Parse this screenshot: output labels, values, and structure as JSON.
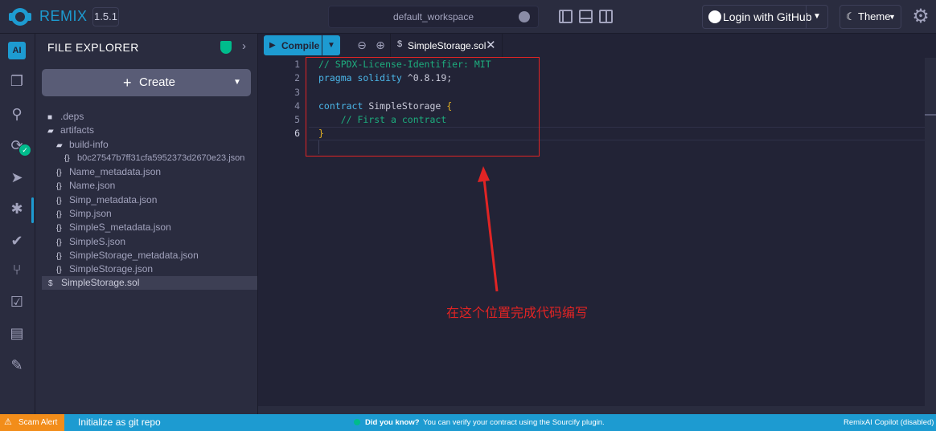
{
  "header": {
    "brand": "REMIX",
    "version": "1.5.1",
    "workspace": "default_workspace",
    "github_label": "Login with GitHub",
    "theme_label": "Theme"
  },
  "icons": [
    "ai-icon",
    "files-icon",
    "search-icon",
    "compiler-icon",
    "deploy-icon",
    "debugger-icon",
    "testing-icon",
    "git-icon",
    "static-analysis-icon",
    "learneth-icon",
    "plugin-manager-icon",
    "gear-icon"
  ],
  "explorer": {
    "title": "FILE EXPLORER",
    "create_label": "Create",
    "tree": [
      {
        "name": ".deps",
        "type": "folder"
      },
      {
        "name": "artifacts",
        "type": "folder-open"
      },
      {
        "name": "build-info",
        "type": "folder-open"
      },
      {
        "name": "b0c27547b7ff31cfa5952373d2670e23.json",
        "type": "json"
      },
      {
        "name": "Name_metadata.json",
        "type": "json"
      },
      {
        "name": "Name.json",
        "type": "json"
      },
      {
        "name": "Simp_metadata.json",
        "type": "json"
      },
      {
        "name": "Simp.json",
        "type": "json"
      },
      {
        "name": "SimpleS_metadata.json",
        "type": "json"
      },
      {
        "name": "SimpleS.json",
        "type": "json"
      },
      {
        "name": "SimpleStorage_metadata.json",
        "type": "json"
      },
      {
        "name": "SimpleStorage.json",
        "type": "json"
      },
      {
        "name": "SimpleStorage.sol",
        "type": "sol",
        "selected": true
      }
    ]
  },
  "editor": {
    "compile_label": "Compile",
    "tab_name": "SimpleStorage.sol",
    "line_numbers": [
      "1",
      "2",
      "3",
      "4",
      "5",
      "6"
    ],
    "code": {
      "l1": "// SPDX-License-Identifier: MIT",
      "l2_kw": "pragma solidity",
      "l2_ver": " ^0.8.19;",
      "l4_kw": "contract",
      "l4_name": " SimpleStorage ",
      "l4_br": "{",
      "l5": "    // First a contract",
      "l6": "}"
    }
  },
  "annotation": "在这个位置完成代码编写",
  "status": {
    "scam_alert": "Scam Alert",
    "git_init": "Initialize as git repo",
    "did_you_know_title": "Did you know?",
    "did_you_know_msg": "You can verify your contract using the Sourcify plugin.",
    "copilot": "RemixAI Copilot (disabled)"
  },
  "colors": {
    "accent": "#1d9bd1",
    "annotation": "#e02424",
    "warning": "#f28d1a",
    "success": "#00bc8c"
  }
}
